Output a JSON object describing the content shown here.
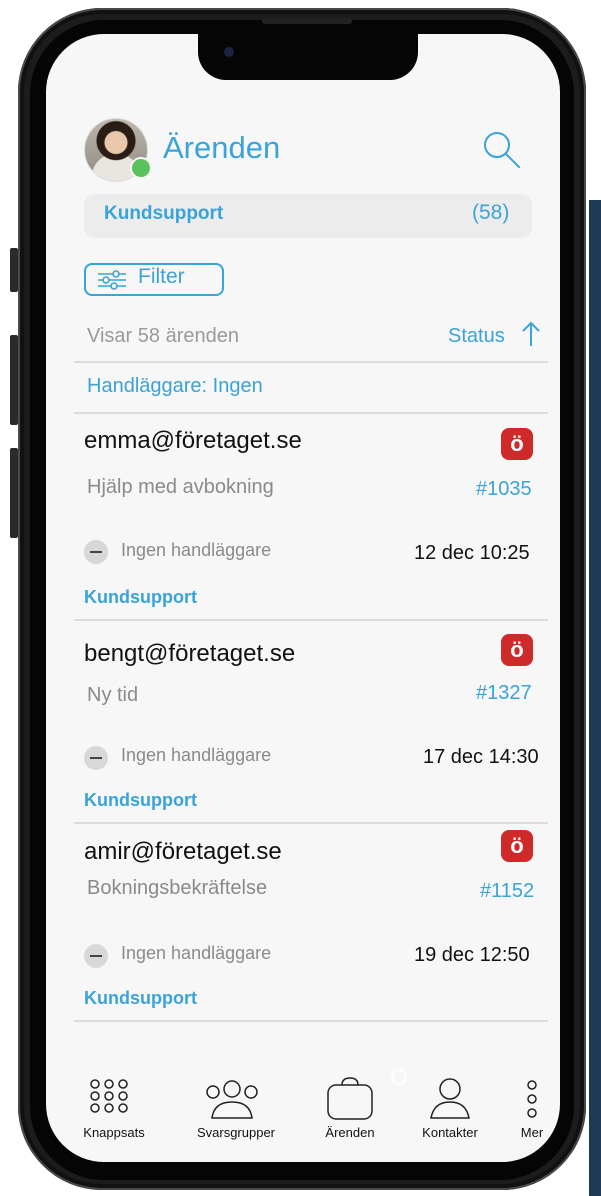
{
  "header": {
    "title": "Ärenden",
    "status_color": "#5ac25a"
  },
  "group": {
    "name": "Kundsupport",
    "count": "(58)"
  },
  "filter": {
    "label": "Filter"
  },
  "list_info": {
    "showing": "Visar 58 ärenden",
    "sort_label": "Status",
    "handler_filter": "Handläggare: Ingen"
  },
  "tickets": [
    {
      "email": "emma@företaget.se",
      "subject": "Hjälp med avbokning",
      "number": "#1035",
      "handler": "Ingen handläggare",
      "datetime": "12 dec 10:25",
      "queue": "Kundsupport",
      "badge": "ö"
    },
    {
      "email": "bengt@företaget.se",
      "subject": "Ny tid",
      "number": "#1327",
      "handler": "Ingen handläggare",
      "datetime": "17 dec 14:30",
      "queue": "Kundsupport",
      "badge": "ö"
    },
    {
      "email": "amir@företaget.se",
      "subject": "Bokningsbekräftelse",
      "number": "#1152",
      "handler": "Ingen handläggare",
      "datetime": "19 dec 12:50",
      "queue": "Kundsupport",
      "badge": "ö"
    }
  ],
  "tabbar": [
    {
      "label": "Knappsats",
      "icon": "keypad-icon"
    },
    {
      "label": "Svarsgrupper",
      "icon": "groups-icon"
    },
    {
      "label": "Ärenden",
      "icon": "briefcase-icon"
    },
    {
      "label": "Kontakter",
      "icon": "person-icon"
    },
    {
      "label": "Mer",
      "icon": "more-icon"
    }
  ],
  "colors": {
    "accent": "#3aa3d8",
    "brand_badge": "#cf2a2a",
    "background": "#f7f7f7"
  }
}
